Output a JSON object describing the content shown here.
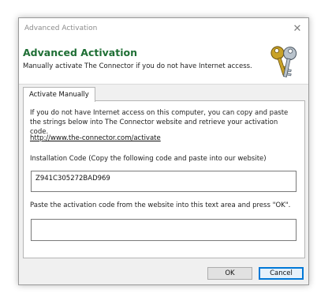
{
  "window": {
    "title": "Advanced Activation",
    "close_symbol": "✕"
  },
  "header": {
    "title": "Advanced Activation",
    "subtitle": "Manually activate The Connector if you do not have Internet access.",
    "icon": "keys-icon"
  },
  "tabs": [
    {
      "label": "Activate Manually",
      "selected": true
    }
  ],
  "panel": {
    "instructions": "If you do not have Internet access on this computer, you can copy and paste the strings below into The Connector website and retrieve your activation code.",
    "link": "http://www.the-connector.com/activate",
    "installation_label": "Installation Code (Copy the following code and paste into our website)",
    "installation_code": "Z941C305272BAD969",
    "activation_label": "Paste the activation code from the website into this text area and press \"OK\".",
    "activation_code": ""
  },
  "buttons": {
    "ok": "OK",
    "cancel": "Cancel"
  },
  "colors": {
    "header_title": "#1f6f35",
    "focus_border": "#0078d7"
  }
}
